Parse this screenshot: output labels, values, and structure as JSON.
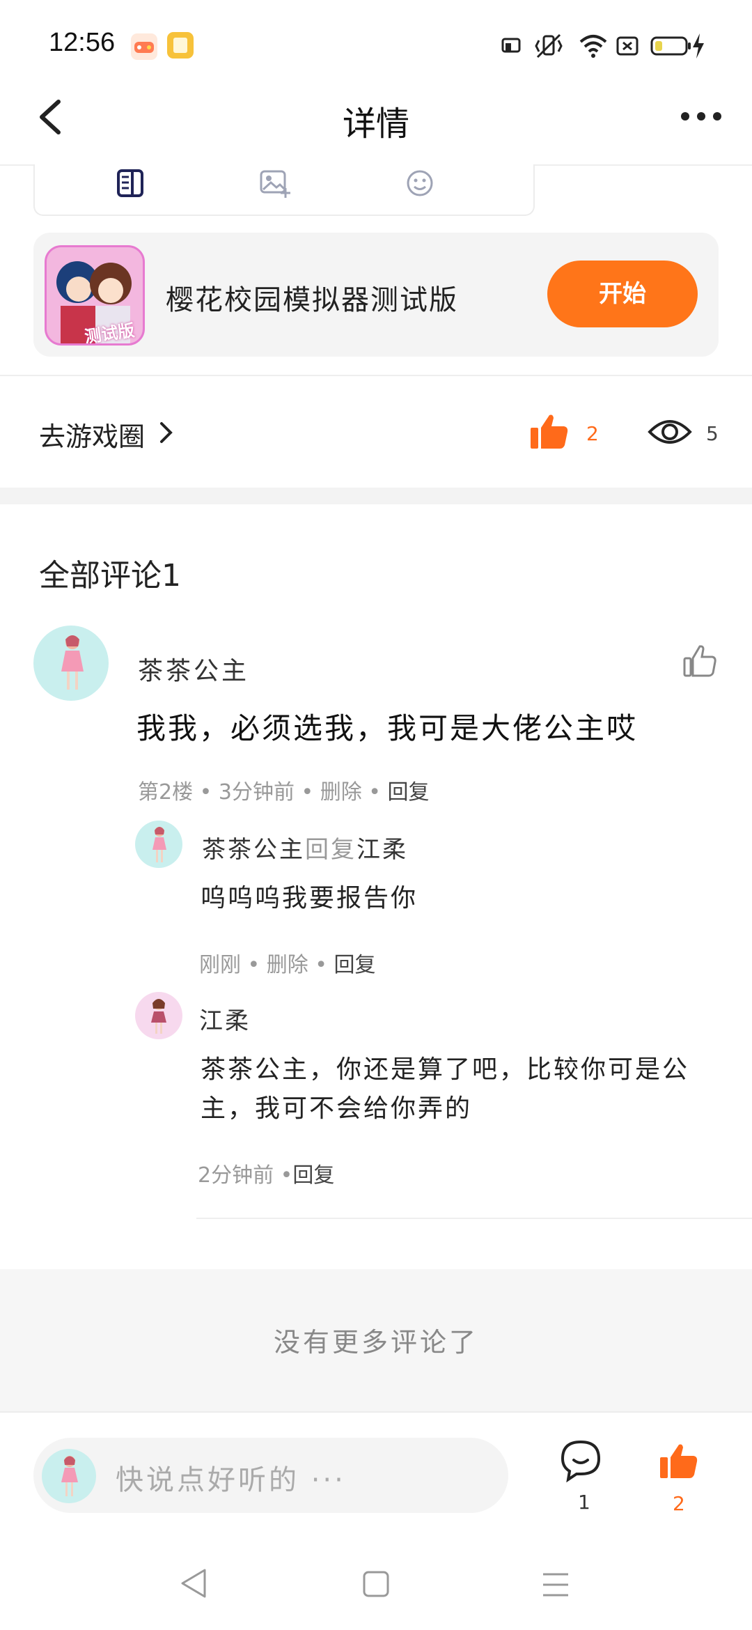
{
  "status_bar": {
    "time": "12:56",
    "icons": [
      "game-app-icon",
      "notes-app-icon",
      "cast-icon",
      "vibrate-icon",
      "wifi-icon",
      "sim-icon",
      "battery-icon",
      "charging-icon"
    ]
  },
  "header": {
    "title": "详情",
    "back_icon": "chevron-left-icon",
    "more_icon": "more-dots-icon"
  },
  "toolbar": {
    "icons": [
      "document-icon",
      "image-add-icon",
      "emoji-icon"
    ]
  },
  "game_card": {
    "name": "樱花校园模拟器测试版",
    "thumb_badge": "测试版",
    "button_label": "开始"
  },
  "stats_row": {
    "circle_link": "去游戏圈",
    "like_count": "2",
    "view_count": "5"
  },
  "comments": {
    "title": "全部评论1",
    "items": [
      {
        "author": "茶茶公主",
        "text": "我我，必须选我，我可是大佬公主哎",
        "meta_prefix": "第2楼 • 3分钟前 • 删除 • ",
        "meta_reply": "回复",
        "replies": [
          {
            "author": "茶茶公主",
            "reply_word": "回复",
            "reply_target": "江柔",
            "text": "呜呜呜我要报告你",
            "meta_prefix": "刚刚 • 删除 • ",
            "meta_reply": "回复"
          },
          {
            "author": "江柔",
            "text_line1": "茶茶公主，你还是算了吧，比较你可是公",
            "text_line2": "主，我可不会给你弄的",
            "meta_prefix": "2分钟前 •",
            "meta_reply": "回复"
          }
        ]
      }
    ],
    "no_more": "没有更多评论了"
  },
  "bottom_bar": {
    "input_placeholder": "快说点好听的 ···",
    "comment_count": "1",
    "like_count": "2"
  },
  "colors": {
    "accent": "#ff7519",
    "like": "#ff6a1a"
  }
}
